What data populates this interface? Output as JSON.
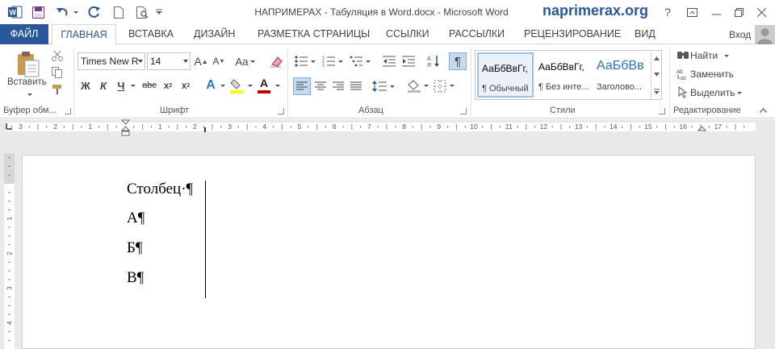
{
  "window": {
    "title": "НАПРИМЕРАХ - Табуляция в Word.docx - Microsoft Word",
    "brand": "naprimerax.org",
    "help_label": "?"
  },
  "tabs": {
    "file": "ФАЙЛ",
    "home": "ГЛАВНАЯ",
    "items": [
      "ВСТАВКА",
      "ДИЗАЙН",
      "РАЗМЕТКА СТРАНИЦЫ",
      "ССЫЛКИ",
      "РАССЫЛКИ",
      "РЕЦЕНЗИРОВАНИЕ",
      "ВИД"
    ],
    "signin": "Вход"
  },
  "clipboard": {
    "paste_label": "Вставить",
    "group_label": "Буфер обм..."
  },
  "font": {
    "name": "Times New R",
    "size": "14",
    "grow": "A",
    "shrink": "A",
    "case": "Aa",
    "bold": "Ж",
    "italic": "К",
    "underline": "Ч",
    "strike": "abc",
    "subscript": "x",
    "superscript": "x",
    "effects": "A",
    "color": "A",
    "group_label": "Шрифт",
    "highlight_color": "#ffff00",
    "font_color": "#c00000"
  },
  "paragraph": {
    "pilcrow": "¶",
    "group_label": "Абзац"
  },
  "styles": {
    "items": [
      {
        "sample": "АаБбВвГг,",
        "name": "¶ Обычный"
      },
      {
        "sample": "АаБбВвГг,",
        "name": "¶ Без инте..."
      },
      {
        "sample": "АаБбВв",
        "name": "Заголово..."
      }
    ],
    "group_label": "Стили"
  },
  "editing": {
    "find": "Найти",
    "replace": "Заменить",
    "select": "Выделить",
    "group_label": "Редактирование"
  },
  "ruler": {
    "numbers": [
      "3",
      "2",
      "1",
      "1",
      "2",
      "3",
      "4",
      "5",
      "6",
      "7",
      "8",
      "9",
      "10",
      "11",
      "12",
      "13",
      "14",
      "15",
      "16",
      "17"
    ],
    "vnumbers": [
      "1",
      "1",
      "2",
      "3",
      "4"
    ]
  },
  "document": {
    "lines": [
      "Столбец·¶",
      "А¶",
      "Б¶",
      "В¶"
    ]
  },
  "colors": {
    "accent": "#2b579a",
    "ribbon_border": "#d4d4d4"
  }
}
